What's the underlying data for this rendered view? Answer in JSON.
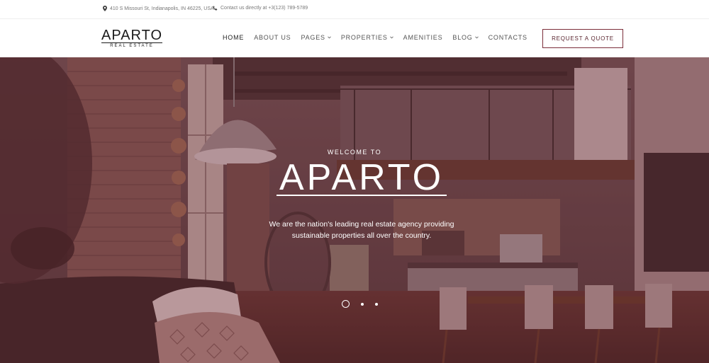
{
  "topbar": {
    "address": "410 S Missouri St, Indianapolis, IN 46225, USA",
    "phone": "Contact us directly at +3(123) 789-5789",
    "address_icon": "map-pin-icon",
    "phone_icon": "phone-icon"
  },
  "logo": {
    "name": "APARTO",
    "subtitle": "REAL ESTATE"
  },
  "nav": {
    "items": [
      {
        "label": "HOME",
        "active": true,
        "has_dropdown": false
      },
      {
        "label": "ABOUT US",
        "active": false,
        "has_dropdown": false
      },
      {
        "label": "PAGES",
        "active": false,
        "has_dropdown": true
      },
      {
        "label": "PROPERTIES",
        "active": false,
        "has_dropdown": true
      },
      {
        "label": "AMENITIES",
        "active": false,
        "has_dropdown": false
      },
      {
        "label": "BLOG",
        "active": false,
        "has_dropdown": true
      },
      {
        "label": "CONTACTS",
        "active": false,
        "has_dropdown": false
      }
    ]
  },
  "cta": {
    "label": "REQUEST A QUOTE"
  },
  "hero": {
    "welcome": "WELCOME TO",
    "title": "APARTO",
    "description": "We are the nation's leading real estate agency providing sustainable properties all over the country.",
    "slides_count": 3,
    "active_slide": 1
  },
  "colors": {
    "accent": "#7b2e3a",
    "overlay": "#76343e"
  }
}
